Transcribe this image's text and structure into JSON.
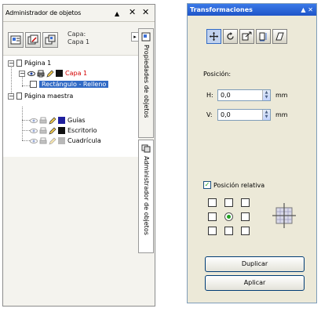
{
  "object_manager": {
    "title": "Administrador de objetos",
    "title_buttons": {
      "autohide": "▲",
      "close": "✕"
    },
    "outer_close": "✕",
    "layer_caption_label": "Capa:",
    "layer_caption_value": "Capa 1",
    "scroll_glyph": "▸",
    "toolbar_icons": [
      "show-object-properties-icon",
      "edit-across-layers-icon",
      "layer-manager-view-icon"
    ],
    "tree": {
      "page1": {
        "label": "Página 1",
        "expander": "−"
      },
      "layer1": {
        "label": "Capa 1",
        "color": "#d40000",
        "expander": "−"
      },
      "rectangle": {
        "label": "Rectángulo - Relleno"
      },
      "master": {
        "label": "Página maestra",
        "expander": "−"
      },
      "guides": {
        "label": "Guías",
        "color": "#1f1f9e"
      },
      "desktop": {
        "label": "Escritorio",
        "color": "#111111"
      },
      "grid": {
        "label": "Cuadrícula",
        "color": "#b8b8b8"
      }
    },
    "side_tabs": {
      "properties": "Propiedades de objetos",
      "manager": "Administrador de objetos"
    }
  },
  "transformations": {
    "title": "Transformaciones",
    "title_buttons": "▲ ✕",
    "modes": [
      "position-icon",
      "rotate-icon",
      "scale-mirror-icon",
      "size-icon",
      "skew-icon"
    ],
    "active_mode": 0,
    "section_label": "Posición:",
    "h": {
      "label": "H:",
      "value": "0,0",
      "unit": "mm"
    },
    "v": {
      "label": "V:",
      "value": "0,0",
      "unit": "mm"
    },
    "relative": {
      "label": "Posición relativa",
      "checked": true,
      "mark": "✓"
    },
    "anchor_selected": "center",
    "spin_up": "▲",
    "spin_down": "▼",
    "duplicate_label": "Duplicar",
    "apply_label": "Aplicar"
  }
}
